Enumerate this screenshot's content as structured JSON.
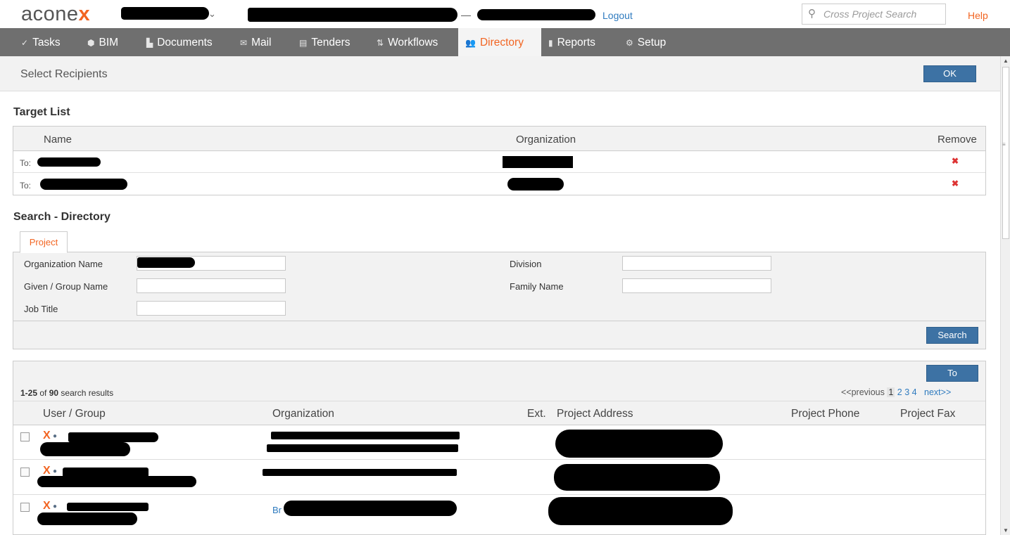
{
  "header": {
    "logo_text": "acone",
    "logo_x": "x",
    "separator": "—",
    "logout": "Logout",
    "search_placeholder": "Cross Project Search",
    "help": "Help"
  },
  "nav": [
    {
      "label": "Tasks",
      "icon": "✓",
      "icon_name": "check-icon"
    },
    {
      "label": "BIM",
      "icon": "⬢",
      "icon_name": "cube-icon"
    },
    {
      "label": "Documents",
      "icon": "▙",
      "icon_name": "document-icon"
    },
    {
      "label": "Mail",
      "icon": "✉",
      "icon_name": "mail-icon"
    },
    {
      "label": "Tenders",
      "icon": "▤",
      "icon_name": "tender-icon"
    },
    {
      "label": "Workflows",
      "icon": "⇅",
      "icon_name": "workflow-icon"
    },
    {
      "label": "Directory",
      "icon": "👥",
      "icon_name": "people-icon",
      "active": true
    },
    {
      "label": "Reports",
      "icon": "▮",
      "icon_name": "bar-chart-icon"
    },
    {
      "label": "Setup",
      "icon": "⚙",
      "icon_name": "gear-icon"
    }
  ],
  "page": {
    "title": "Select Recipients",
    "ok": "OK"
  },
  "target_list": {
    "title": "Target List",
    "columns": {
      "name": "Name",
      "organization": "Organization",
      "remove": "Remove"
    },
    "rows": [
      {
        "type": "To:",
        "remove_icon": "✖"
      },
      {
        "type": "To:",
        "remove_icon": "✖"
      }
    ]
  },
  "search": {
    "title": "Search - Directory",
    "tab": "Project",
    "labels": {
      "org_name": "Organization Name",
      "given_name": "Given / Group Name",
      "job_title": "Job Title",
      "division": "Division",
      "family_name": "Family Name"
    },
    "button": "Search"
  },
  "results": {
    "to_button": "To",
    "count_range": "1-25",
    "count_of": " of ",
    "count_total": "90",
    "count_suffix": " search results",
    "pager": {
      "prev": "<<previous",
      "pages": [
        "1",
        "2",
        "3",
        "4"
      ],
      "next": "next>>"
    },
    "columns": {
      "user": "User / Group",
      "org": "Organization",
      "ext": "Ext.",
      "address": "Project Address",
      "phone": "Project Phone",
      "fax": "Project Fax"
    },
    "rows": [
      {
        "icon_x": "X",
        "org_prefix": ""
      },
      {
        "icon_x": "X",
        "org_prefix": ""
      },
      {
        "icon_x": "X",
        "org_prefix": "Br"
      }
    ]
  },
  "colors": {
    "brand_orange": "#f26522",
    "nav_bg": "#6f6f6f",
    "button_blue": "#3d72a4",
    "link_blue": "#2f7bbf"
  }
}
